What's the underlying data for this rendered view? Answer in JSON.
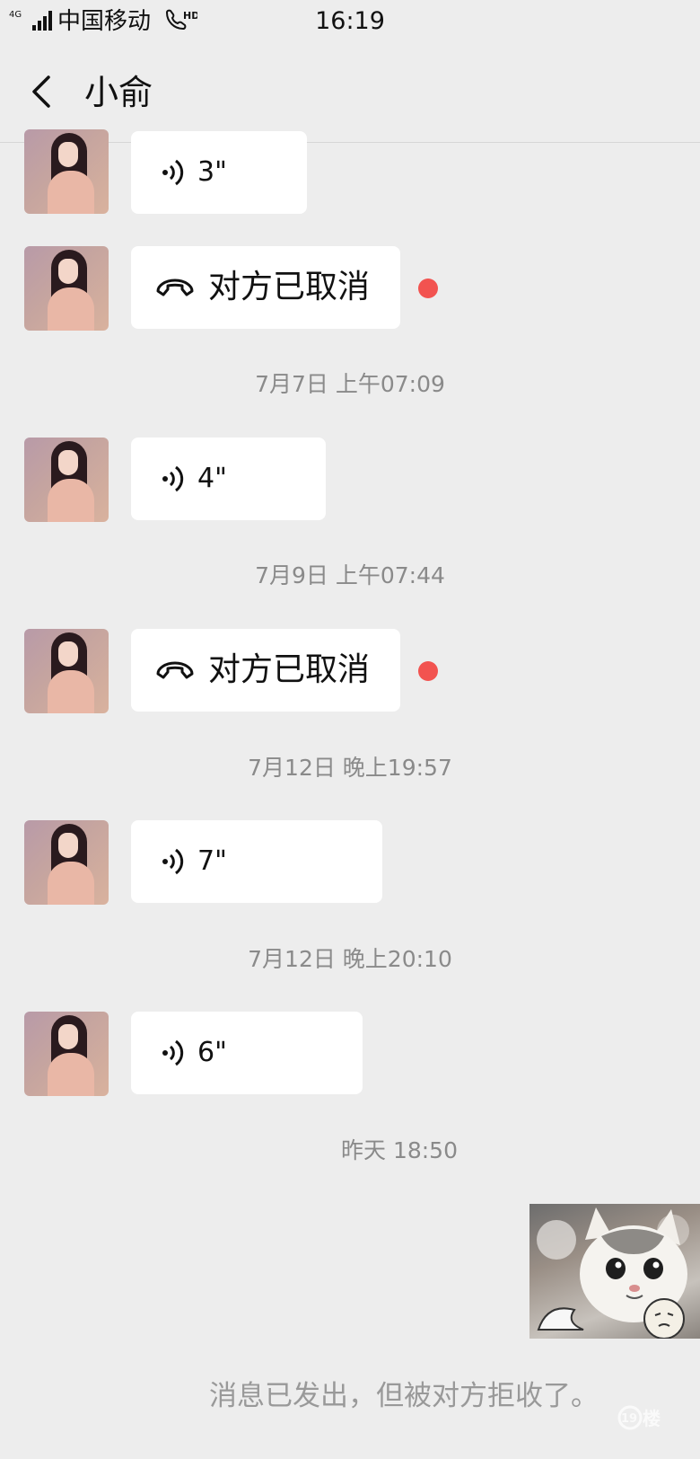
{
  "status_bar": {
    "network": "4G",
    "carrier": "中国移动",
    "hd_label": "HD",
    "time": "16:19"
  },
  "nav": {
    "title": "小俞"
  },
  "messages": [
    {
      "kind": "voice",
      "duration": "3\""
    },
    {
      "kind": "call",
      "text": "对方已取消",
      "unread": true
    },
    {
      "kind": "timestamp",
      "text": "7月7日 上午07:09"
    },
    {
      "kind": "voice",
      "duration": "4\""
    },
    {
      "kind": "timestamp",
      "text": "7月9日 上午07:44"
    },
    {
      "kind": "call",
      "text": "对方已取消",
      "unread": true
    },
    {
      "kind": "timestamp",
      "text": "7月12日 晚上19:57"
    },
    {
      "kind": "voice",
      "duration": "7\""
    },
    {
      "kind": "timestamp",
      "text": "7月12日 晚上20:10"
    },
    {
      "kind": "voice",
      "duration": "6\""
    },
    {
      "kind": "timestamp",
      "text": "昨天 18:50"
    },
    {
      "kind": "sticker",
      "description": "cat-sticker"
    }
  ],
  "system_notice": "消息已发出，但被对方拒收了。",
  "watermark": "19楼",
  "colors": {
    "background": "#ededed",
    "bubble": "#ffffff",
    "unread_dot": "#f25350",
    "timestamp_text": "#8a8a8a"
  }
}
